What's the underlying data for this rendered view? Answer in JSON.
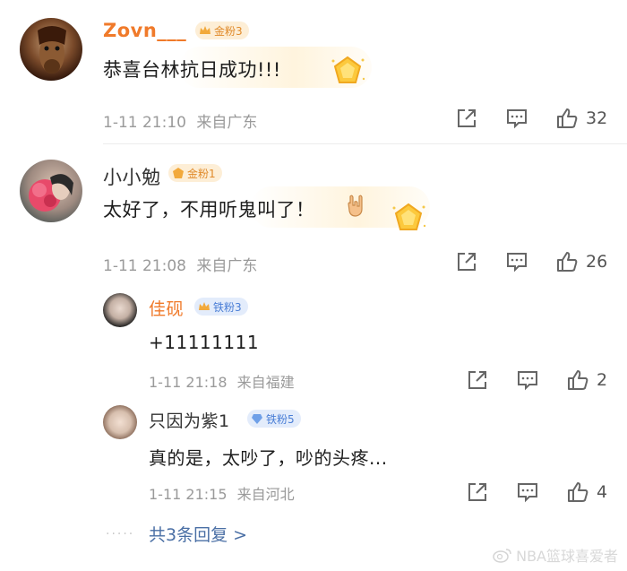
{
  "comments": [
    {
      "name": "Zovn___",
      "name_color": "#f07a2a",
      "badge": "金粉3",
      "text": "恭喜台林抗日成功!!!",
      "time": "1-11 21:10",
      "location": "来自广东",
      "likes": "32",
      "sticker": "gold-badge-sticker"
    },
    {
      "name": "小小勉",
      "name_color": "#333333",
      "badge": "金粉1",
      "text": "太好了，不用听鬼叫了！",
      "emoji": "rock-on-hand-icon",
      "time": "1-11 21:08",
      "location": "来自广东",
      "likes": "26",
      "sticker": "gold-badge-sticker",
      "replies": [
        {
          "name": "佳砚",
          "name_color": "#f07a2a",
          "badge": "铁粉3",
          "text": "+11111111",
          "time": "1-11 21:18",
          "location": "来自福建",
          "likes": "2"
        },
        {
          "name": "只因为紫1",
          "name_color": "#333333",
          "badge": "铁粉5",
          "text": "真的是，太吵了，吵的头疼...",
          "time": "1-11 21:15",
          "location": "来自河北",
          "likes": "4"
        }
      ],
      "more_replies": "共3条回复 >"
    }
  ],
  "watermark": "NBA篮球喜爱者",
  "colors": {
    "gold_badge_bg": "#fdeed6",
    "gold_badge_text": "#e08a2a",
    "iron_badge_bg": "#e3ecfb",
    "iron_badge_text": "#4a7ed6"
  }
}
